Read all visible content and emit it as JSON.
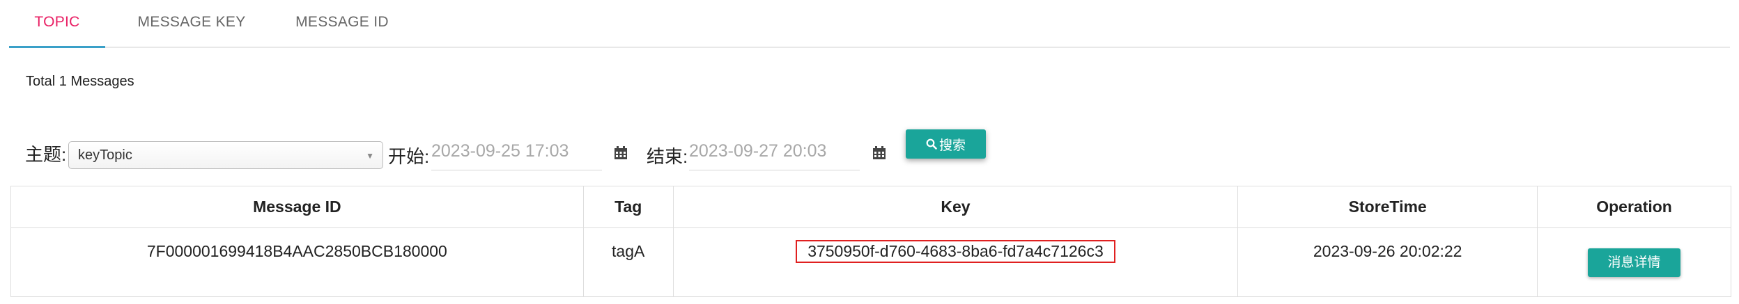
{
  "tabs": [
    {
      "label": "TOPIC",
      "active": true
    },
    {
      "label": "MESSAGE KEY",
      "active": false
    },
    {
      "label": "MESSAGE ID",
      "active": false
    }
  ],
  "summary": {
    "total_text": "Total 1 Messages"
  },
  "filter": {
    "topic_label": "主题:",
    "topic_value": "keyTopic",
    "start_label": "开始:",
    "start_value": "2023-09-25 17:03",
    "end_label": "结束:",
    "end_value": "2023-09-27 20:03",
    "search_label": "搜索",
    "search_icon": "search-icon",
    "calendar_icon": "calendar-icon"
  },
  "table": {
    "headers": [
      "Message ID",
      "Tag",
      "Key",
      "StoreTime",
      "Operation"
    ],
    "rows": [
      {
        "message_id": "7F000001699418B4AAC2850BCB180000",
        "tag": "tagA",
        "key": "3750950f-d760-4683-8ba6-fd7a4c7126c3",
        "store_time": "2023-09-26 20:02:22",
        "operation_label": "消息详情"
      }
    ]
  },
  "colors": {
    "accent": "#e91e63",
    "tab_ink": "#3aa0c8",
    "button": "#1aa59a",
    "highlight_box": "#e02020"
  }
}
